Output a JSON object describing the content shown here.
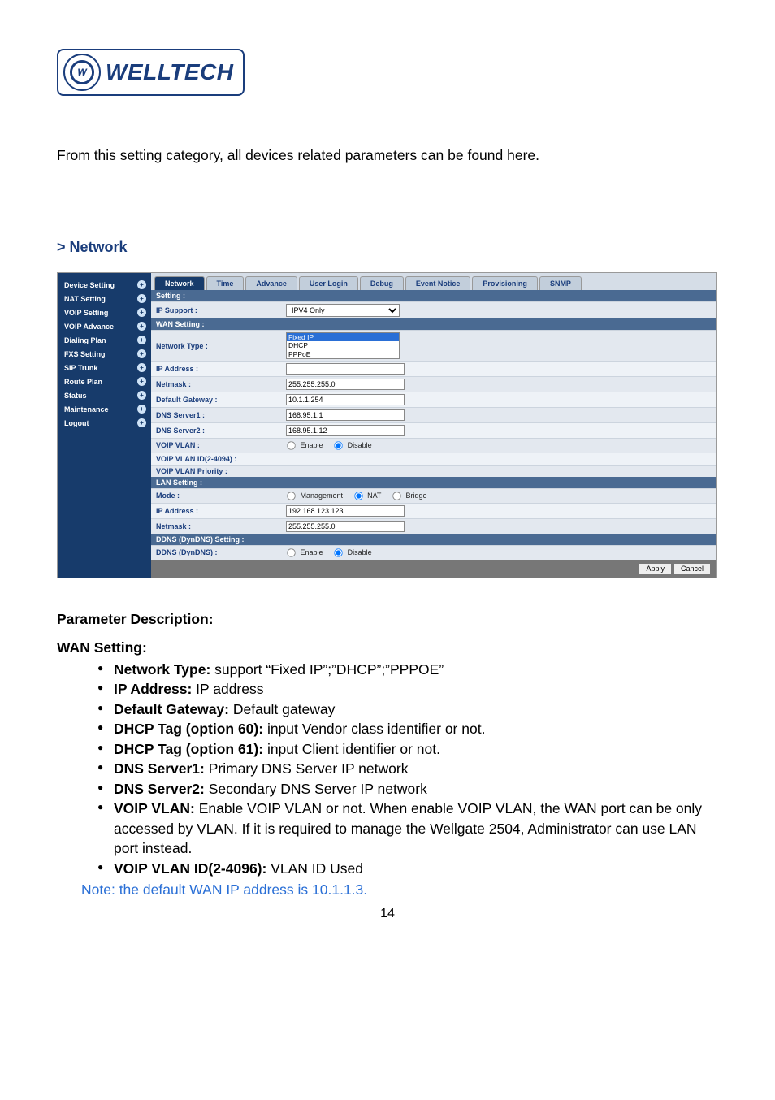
{
  "logo": {
    "monogram": "W",
    "text": "WELLTECH"
  },
  "intro": "From this setting category, all devices related parameters can be found here.",
  "section_heading": "> Network",
  "shot": {
    "sidebar": {
      "items": [
        {
          "label": "Device Setting"
        },
        {
          "label": "NAT Setting"
        },
        {
          "label": "VOIP Setting"
        },
        {
          "label": "VOIP Advance"
        },
        {
          "label": "Dialing Plan"
        },
        {
          "label": "FXS Setting"
        },
        {
          "label": "SIP Trunk"
        },
        {
          "label": "Route Plan"
        },
        {
          "label": "Status"
        },
        {
          "label": "Maintenance"
        },
        {
          "label": "Logout"
        }
      ]
    },
    "tabs": [
      "Network",
      "Time",
      "Advance",
      "User Login",
      "Debug",
      "Event Notice",
      "Provisioning",
      "SNMP"
    ],
    "sections": {
      "setting_hdr": "Setting :",
      "ip_support": {
        "label": "IP Support :",
        "value": "IPV4 Only"
      },
      "wan_hdr": "WAN Setting :",
      "network_type": {
        "label": "Network Type :",
        "options": [
          "Fixed IP",
          "DHCP",
          "PPPoE"
        ],
        "selected": "Fixed IP"
      },
      "ip_address": {
        "label": "IP Address :",
        "value": ""
      },
      "netmask": {
        "label": "Netmask :",
        "value": "255.255.255.0"
      },
      "default_gw": {
        "label": "Default Gateway :",
        "value": "10.1.1.254"
      },
      "dns1": {
        "label": "DNS Server1 :",
        "value": "168.95.1.1"
      },
      "dns2": {
        "label": "DNS Server2 :",
        "value": "168.95.1.12"
      },
      "voip_vlan": {
        "label": "VOIP VLAN :",
        "enable": "Enable",
        "disable": "Disable",
        "checked": "disable"
      },
      "vlan_id": {
        "label": "VOIP VLAN ID(2-4094) :",
        "value": ""
      },
      "vlan_prio": {
        "label": "VOIP VLAN Priority :",
        "value": ""
      },
      "lan_hdr": "LAN Setting :",
      "mode": {
        "label": "Mode :",
        "options": [
          "Management",
          "NAT",
          "Bridge"
        ],
        "checked": "NAT"
      },
      "lan_ip": {
        "label": "IP Address :",
        "value": "192.168.123.123"
      },
      "lan_nm": {
        "label": "Netmask :",
        "value": "255.255.255.0"
      },
      "ddns_hdr": "DDNS (DynDNS) Setting :",
      "ddns": {
        "label": "DDNS (DynDNS) :",
        "enable": "Enable",
        "disable": "Disable",
        "checked": "disable"
      }
    },
    "buttons": {
      "apply": "Apply",
      "cancel": "Cancel"
    }
  },
  "desc": {
    "param_heading": "Parameter Description:",
    "wan_heading": "WAN Setting:",
    "bullets": [
      {
        "b": "Network Type:",
        "t": " support “Fixed IP”;”DHCP”;”PPPOE”"
      },
      {
        "b": "IP Address:",
        "t": " IP address"
      },
      {
        "b": "Default Gateway:",
        "t": " Default gateway"
      },
      {
        "b": "DHCP Tag (option 60):",
        "t": " input Vendor class identifier or not."
      },
      {
        "b": "DHCP Tag (option 61):",
        "t": " input Client identifier or not."
      },
      {
        "b": "DNS Server1:",
        "t": " Primary DNS Server IP network"
      },
      {
        "b": "DNS Server2:",
        "t": " Secondary DNS Server IP network"
      },
      {
        "b": "VOIP VLAN:",
        "t": " Enable VOIP VLAN or not. When enable VOIP VLAN, the WAN port can be only accessed by VLAN. If it is required to manage the Wellgate 2504, Administrator can use LAN port instead."
      },
      {
        "b": "VOIP VLAN ID(2-4096):",
        "t": " VLAN ID Used"
      }
    ],
    "note": "Note: the default WAN IP address is 10.1.1.3.",
    "page": "14"
  }
}
